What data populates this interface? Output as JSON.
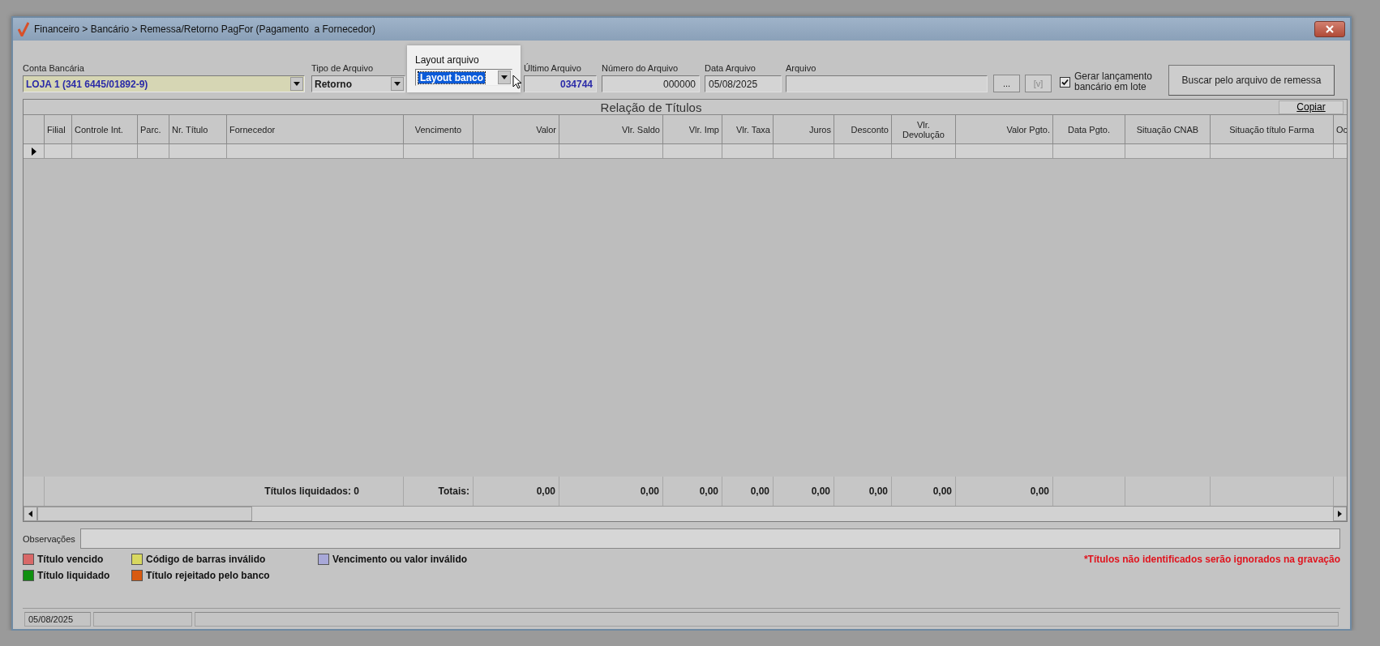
{
  "window": {
    "title": "Financeiro > Bancário > Remessa/Retorno PagFor (Pagamento  a Fornecedor)"
  },
  "fields": {
    "conta": {
      "label": "Conta Bancária",
      "value": "LOJA 1 (341 6445/01892-9)"
    },
    "tipo": {
      "label": "Tipo de Arquivo",
      "value": "Retorno"
    },
    "layout": {
      "label": "Layout arquivo",
      "value": "Layout banco",
      "focused": true
    },
    "ultimo": {
      "label": "Último Arquivo",
      "value": "034744"
    },
    "numero": {
      "label": "Número do Arquivo",
      "value": "000000"
    },
    "data": {
      "label": "Data Arquivo",
      "value": "05/08/2025"
    },
    "arquivo": {
      "label": "Arquivo"
    }
  },
  "browse_button": "...",
  "view_button": "[v]",
  "batch_checkbox": {
    "label": "Gerar lançamento bancário em lote",
    "checked": true
  },
  "search_button": "Buscar pelo arquivo de remessa",
  "table": {
    "caption": "Relação de Títulos",
    "copy_button": "Copiar",
    "columns": [
      {
        "label": "Filial"
      },
      {
        "label": "Controle Int."
      },
      {
        "label": "Parc."
      },
      {
        "label": "Nr. Título"
      },
      {
        "label": "Fornecedor"
      },
      {
        "label": "Vencimento"
      },
      {
        "label": "Valor"
      },
      {
        "label": "Vlr. Saldo"
      },
      {
        "label": "Vlr. Imp"
      },
      {
        "label": "Vlr. Taxa"
      },
      {
        "label": "Juros"
      },
      {
        "label": "Desconto"
      },
      {
        "label": "Vlr.\nDevolução"
      },
      {
        "label": "Valor Pgto."
      },
      {
        "label": "Data Pgto."
      },
      {
        "label": "Situação CNAB"
      },
      {
        "label": "Situação título Farma"
      },
      {
        "label": "Oc"
      }
    ],
    "rows": [
      {
        "current": true
      }
    ],
    "totals": {
      "count": "Títulos liquidados: 0",
      "label": "Totais:",
      "values": [
        "0,00",
        "0,00",
        "0,00",
        "0,00",
        "0,00",
        "0,00",
        "0,00",
        "0,00"
      ]
    }
  },
  "observacoes": {
    "label": "Observações"
  },
  "legend": [
    {
      "label": "Título vencido",
      "color": "#d86868"
    },
    {
      "label": "Código de barras inválido",
      "color": "#d8d860"
    },
    {
      "label": "Vencimento ou valor inválido",
      "color": "#a8a8d8"
    },
    {
      "label": "Título liquidado",
      "color": "#109010"
    },
    {
      "label": "Título rejeitado pelo banco",
      "color": "#d85a10"
    }
  ],
  "note": "*Títulos não identificados serão ignorados na gravação",
  "status_bar": {
    "date": "05/08/2025"
  }
}
